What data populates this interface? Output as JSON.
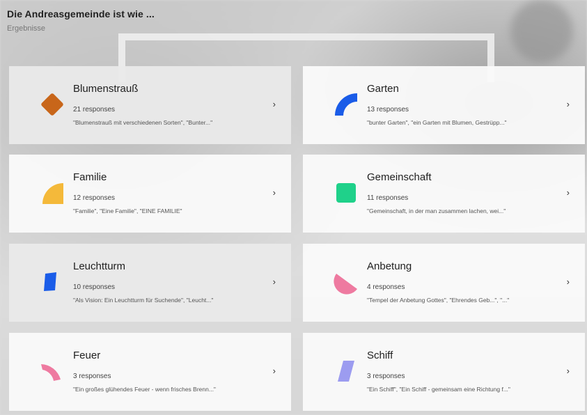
{
  "header": {
    "title": "Die Andreasgemeinde ist wie ...",
    "subtitle": "Ergebnisse"
  },
  "colors": {
    "orange": "#c8661a",
    "blue": "#1a5ce8",
    "yellow": "#f4b93a",
    "green": "#1fd18a",
    "pink": "#ee7aa0",
    "lavender": "#9c9cf0"
  },
  "cards": [
    {
      "label": "Blumenstrauß",
      "count": "21 responses",
      "quotes": "\"Blumenstrauß mit verschiedenen Sorten\", \"Bunter...\"",
      "icon": "orange-diamond-icon"
    },
    {
      "label": "Garten",
      "count": "13 responses",
      "quotes": "\"bunter Garten\", \"ein Garten mit Blumen, Gestrüpp...\"",
      "icon": "blue-arc-icon"
    },
    {
      "label": "Familie",
      "count": "12 responses",
      "quotes": "\"Familie\", \"Eine Familie\", \"EINE FAMILIE\"",
      "icon": "yellow-quarter-circle-icon"
    },
    {
      "label": "Gemeinschaft",
      "count": "11 responses",
      "quotes": "\"Gemeinschaft, in der man zusammen lachen, wei...\"",
      "icon": "green-square-icon"
    },
    {
      "label": "Leuchtturm",
      "count": "10 responses",
      "quotes": "\"Als Vision: Ein Leuchtturm für Suchende\", \"Leucht...\"",
      "icon": "blue-tilted-rect-icon"
    },
    {
      "label": "Anbetung",
      "count": "4 responses",
      "quotes": "\"Tempel der Anbetung Gottes\", \"Ehrendes Geb...\", \"...\"",
      "icon": "pink-half-circle-icon"
    },
    {
      "label": "Feuer",
      "count": "3 responses",
      "quotes": "\"Ein großes glühendes Feuer - wenn frisches Brenn...\"",
      "icon": "pink-arc-icon"
    },
    {
      "label": "Schiff",
      "count": "3 responses",
      "quotes": "\"Ein Schiff\", \"Ein Schiff - gemeinsam eine Richtung f...\"",
      "icon": "lavender-parallelogram-icon"
    }
  ],
  "chevron": "›"
}
